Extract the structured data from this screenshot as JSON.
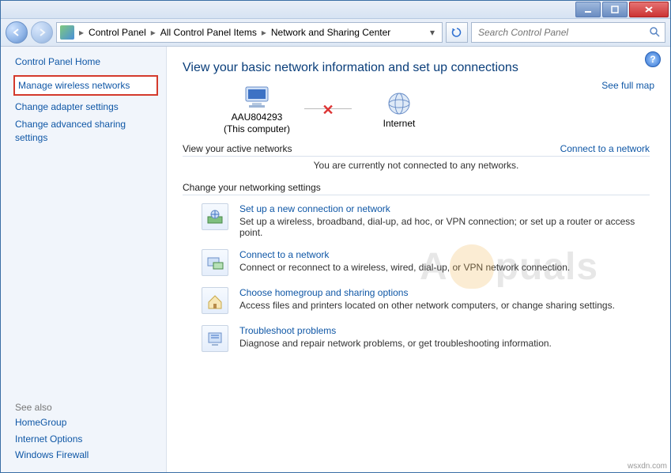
{
  "breadcrumbs": {
    "root_icon": "control-panel",
    "items": [
      "Control Panel",
      "All Control Panel Items",
      "Network and Sharing Center"
    ]
  },
  "search": {
    "placeholder": "Search Control Panel"
  },
  "sidebar": {
    "home": "Control Panel Home",
    "links": [
      {
        "label": "Manage wireless networks",
        "highlight": true
      },
      {
        "label": "Change adapter settings",
        "highlight": false
      },
      {
        "label": "Change advanced sharing settings",
        "highlight": false
      }
    ],
    "see_also_header": "See also",
    "see_also": [
      {
        "label": "HomeGroup"
      },
      {
        "label": "Internet Options"
      },
      {
        "label": "Windows Firewall"
      }
    ]
  },
  "main": {
    "heading": "View your basic network information and set up connections",
    "see_full_map": "See full map",
    "map": {
      "left": {
        "name": "AAU804293",
        "sub": "(This computer)"
      },
      "right": {
        "name": "Internet"
      },
      "connection_broken": true
    },
    "active_header": "View your active networks",
    "connect_link": "Connect to a network",
    "active_status": "You are currently not connected to any networks.",
    "change_header": "Change your networking settings",
    "tasks": [
      {
        "title": "Set up a new connection or network",
        "desc": "Set up a wireless, broadband, dial-up, ad hoc, or VPN connection; or set up a router or access point."
      },
      {
        "title": "Connect to a network",
        "desc": "Connect or reconnect to a wireless, wired, dial-up, or VPN network connection."
      },
      {
        "title": "Choose homegroup and sharing options",
        "desc": "Access files and printers located on other network computers, or change sharing settings."
      },
      {
        "title": "Troubleshoot problems",
        "desc": "Diagnose and repair network problems, or get troubleshooting information."
      }
    ]
  },
  "watermark": {
    "text_before": "A",
    "text_after": "puals"
  },
  "source_tag": "wsxdn.com"
}
